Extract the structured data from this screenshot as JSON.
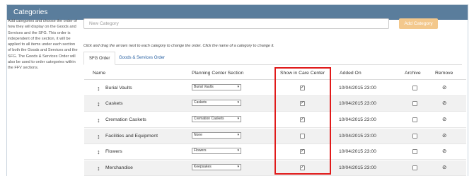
{
  "panel": {
    "title": "Categories"
  },
  "description": "Add categories and choose the order of how they will display on the Goods and Services and the SFG. This order is independent of the section, it will be applied to all items under each section of both the Goods and Services and the SFG. The Goods & Services Order will also be used to order categories within the FFV sections.",
  "new_category": {
    "placeholder": "New Category",
    "button_label": "Add Category"
  },
  "instructions": "Click and drag the arrows next to each category to change the order. Click the name of a category to change it.",
  "tabs": [
    {
      "label": "SFG Order",
      "active": true
    },
    {
      "label": "Goods & Services Order",
      "active": false
    }
  ],
  "table": {
    "headers": {
      "name": "Name",
      "planning": "Planning Center Section",
      "show": "Show in Care Center",
      "added": "Added On",
      "archive": "Archive",
      "remove": "Remove"
    },
    "rows": [
      {
        "name": "Burial Vaults",
        "section": "Burial Vaults",
        "show": true,
        "added": "10/04/2015 23:00",
        "archive": false
      },
      {
        "name": "Caskets",
        "section": "Caskets",
        "show": true,
        "added": "10/04/2015 23:00",
        "archive": false
      },
      {
        "name": "Cremation Caskets",
        "section": "Cremation Caskets",
        "show": true,
        "added": "10/04/2015 23:00",
        "archive": false
      },
      {
        "name": "Facilities and Equipment",
        "section": "None",
        "show": false,
        "added": "10/04/2015 23:00",
        "archive": false
      },
      {
        "name": "Flowers",
        "section": "Flowers",
        "show": true,
        "added": "10/04/2015 23:00",
        "archive": false
      },
      {
        "name": "Merchandise",
        "section": "Keepsakes",
        "show": true,
        "added": "10/04/2015 23:00",
        "archive": false
      }
    ]
  },
  "icons": {
    "drag": "drag-handle-icon",
    "remove": "remove-icon",
    "select_caret": "chevron-down-icon"
  },
  "colors": {
    "title_bar": "#5a7d9c",
    "add_button": "#f3c88c",
    "highlight_box": "#e01a1a",
    "tab_link": "#2a62a3"
  }
}
